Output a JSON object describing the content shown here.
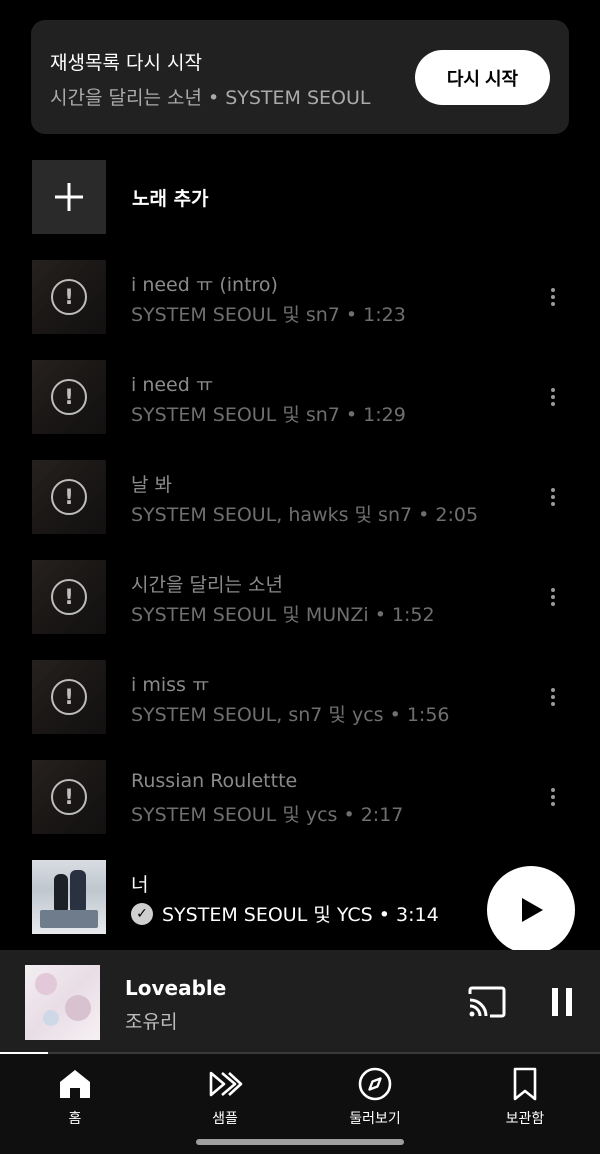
{
  "banner": {
    "title": "재생목록 다시 시작",
    "subtitle": "시간을 달리는 소년 • SYSTEM SEOUL",
    "button_label": "다시 시작"
  },
  "add_song": {
    "label": "노래 추가",
    "icon": "plus-icon"
  },
  "songs": [
    {
      "title": "i need ㅠ (intro)",
      "subtitle": "SYSTEM SEOUL 및 sn7 • 1:23",
      "status_icon": "error-icon"
    },
    {
      "title": "i need ㅠ",
      "subtitle": "SYSTEM SEOUL 및 sn7 • 1:29",
      "status_icon": "error-icon"
    },
    {
      "title": "날 봐",
      "subtitle": "SYSTEM SEOUL, hawks 및 sn7 • 2:05",
      "status_icon": "error-icon"
    },
    {
      "title": "시간을 달리는 소년",
      "subtitle": "SYSTEM SEOUL 및 MUNZi • 1:52",
      "status_icon": "error-icon"
    },
    {
      "title": "i miss ㅠ",
      "subtitle": "SYSTEM SEOUL, sn7 및 ycs • 1:56",
      "status_icon": "error-icon"
    },
    {
      "title": "Russian Roulettte",
      "subtitle": "SYSTEM SEOUL 및 ycs • 2:17",
      "status_icon": "error-icon"
    },
    {
      "title": "너",
      "subtitle": "SYSTEM SEOUL 및 YCS • 3:14",
      "status_icon": "check-badge-icon"
    }
  ],
  "mini_player": {
    "title": "Loveable",
    "artist": "조유리",
    "progress": 0.08
  },
  "nav": [
    {
      "label": "홈",
      "icon": "home-icon"
    },
    {
      "label": "샘플",
      "icon": "samples-icon"
    },
    {
      "label": "둘러보기",
      "icon": "explore-icon"
    },
    {
      "label": "보관함",
      "icon": "library-icon"
    }
  ],
  "colors": {
    "background": "#000000",
    "banner": "#212121",
    "mini_player": "#1f1f1f",
    "nav": "#0f0f0f"
  }
}
